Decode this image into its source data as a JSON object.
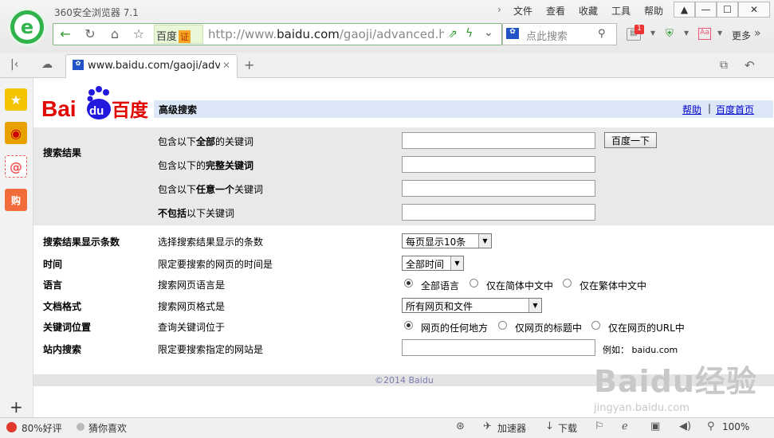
{
  "browser": {
    "title": "360安全浏览器 7.1",
    "menus": [
      "文件",
      "查看",
      "收藏",
      "工具",
      "帮助"
    ],
    "url_prefix": "http://www.",
    "url_domain": "baidu.com",
    "url_path": "/gaoji/advanced.h",
    "engine_badge": "百度",
    "engine_cert": "证",
    "search_placeholder": "点此搜索",
    "more_label": "更多",
    "notif_count": "1",
    "tab_title": "www.baidu.com/gaoji/advan",
    "status_rating": "80%好评",
    "status_guess": "猜你喜欢",
    "status_accel": "加速器",
    "status_download": "下载",
    "status_zoom": "100%"
  },
  "page": {
    "logo_text_bai": "Bai",
    "logo_text_du": "du",
    "logo_text_cn": "百度",
    "header_title": "高级搜索",
    "help_link": "帮助",
    "home_link": "百度首页",
    "search_result_label": "搜索结果",
    "row1_label_a": "包含以下",
    "row1_label_b": "全部",
    "row1_label_c": "的关键词",
    "row2_label_a": "包含以下的",
    "row2_label_b": "完整关键词",
    "row3_label_a": "包含以下",
    "row3_label_b": "任意一个",
    "row3_label_c": "关键词",
    "row4_label_a": "不包括",
    "row4_label_b": "以下关键词",
    "submit_label": "百度一下",
    "count_label": "搜索结果显示条数",
    "count_desc": "选择搜索结果显示的条数",
    "count_value": "每页显示10条",
    "time_label": "时间",
    "time_desc": "限定要搜索的网页的时间是",
    "time_value": "全部时间",
    "lang_label": "语言",
    "lang_desc": "搜索网页语言是",
    "lang_opt1": "全部语言",
    "lang_opt2": "仅在简体中文中",
    "lang_opt3": "仅在繁体中文中",
    "format_label": "文档格式",
    "format_desc": "搜索网页格式是",
    "format_value": "所有网页和文件",
    "pos_label": "关键词位置",
    "pos_desc": "查询关键词位于",
    "pos_opt1": "网页的任何地方",
    "pos_opt2": "仅网页的标题中",
    "pos_opt3": "仅在网页的URL中",
    "site_label": "站内搜索",
    "site_desc": "限定要搜索指定的网站是",
    "site_example": "例如：  baidu.com",
    "copyright": "©2014 Baidu"
  },
  "watermark": {
    "main": "Baidu经验",
    "sub": "jingyan.baidu.com"
  },
  "colors": {
    "accent": "#2fb34a",
    "header_blue": "#dce8f8",
    "link": "#0000cc"
  }
}
